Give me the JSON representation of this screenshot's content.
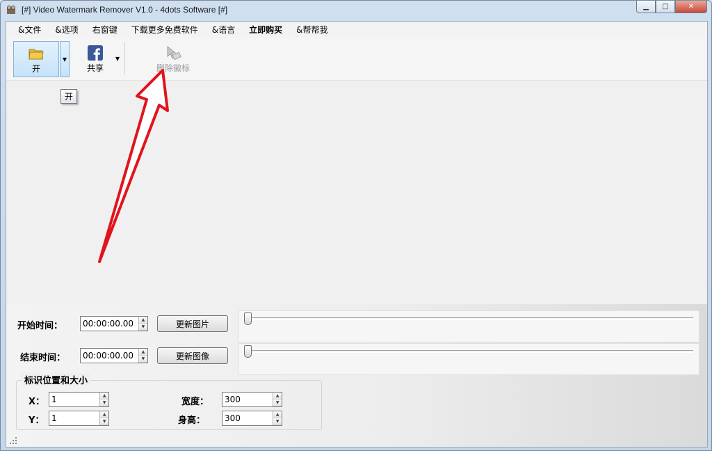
{
  "window": {
    "title": "[#] Video Watermark Remover V1.0 - 4dots Software [#]",
    "minimize_glyph": "▁",
    "maximize_glyph": "□",
    "close_glyph": "✕"
  },
  "menu": {
    "items": [
      {
        "label": "&文件"
      },
      {
        "label": "&选项"
      },
      {
        "label": "右窗键"
      },
      {
        "label": "下载更多免费软件"
      },
      {
        "label": "&语言"
      },
      {
        "label": "立即购买"
      },
      {
        "label": "&帮帮我"
      }
    ]
  },
  "toolbar": {
    "open_label": "开",
    "share_label": "共享",
    "remove_label": "删除徽标",
    "dropdown_glyph": "▾"
  },
  "tooltip": {
    "text": "开"
  },
  "timing": {
    "start_label": "开始时间：",
    "start_value": "00:00:00.00",
    "end_label": "结束时间：",
    "end_value": "00:00:00.00",
    "update_picture_button": "更新图片",
    "update_image_button": "更新图像",
    "start_slider_value": 0,
    "end_slider_value": 0
  },
  "logo_box": {
    "title": "标识位置和大小",
    "x_label": "X：",
    "x_value": "1",
    "y_label": "Y：",
    "y_value": "1",
    "width_label": "宽度：",
    "width_value": "300",
    "height_label": "身高：",
    "height_value": "300"
  },
  "colors": {
    "annotation_arrow": "#e0141c",
    "facebook_blue": "#3b5998",
    "folder_yellow": "#f3c94b"
  },
  "icons": {
    "open": "folder-icon",
    "share": "facebook-icon",
    "remove": "cursor-eraser-icon",
    "app": "film-reel-icon"
  }
}
